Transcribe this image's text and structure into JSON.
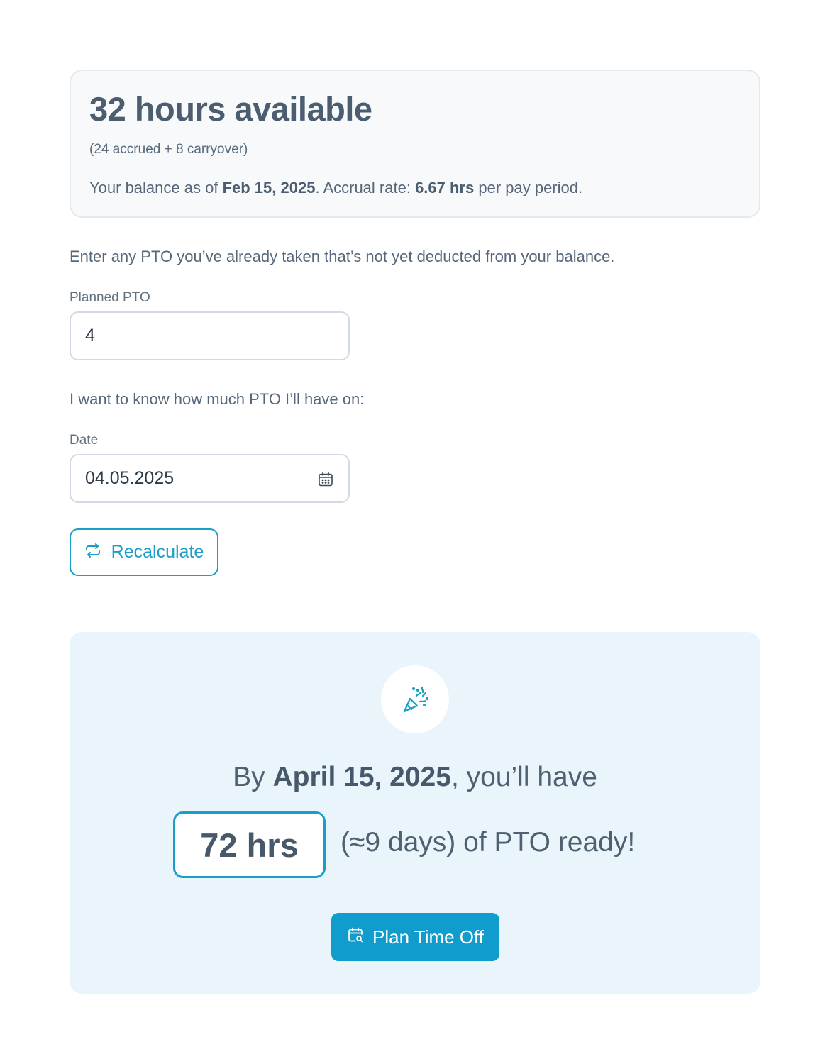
{
  "balance": {
    "title": "32 hours available",
    "breakdown": "(24 accrued + 8 carryover)",
    "info_prefix": "Your balance as of ",
    "as_of_date": "Feb 15, 2025",
    "info_middle": ". Accrual rate: ",
    "accrual_rate": "6.67 hrs",
    "info_suffix": " per pay period."
  },
  "form": {
    "intro": "Enter any PTO you’ve already taken that’s not yet deducted from your balance.",
    "planned_label": "Planned PTO",
    "planned_value": "4",
    "question": "I want to know how much PTO I’ll have on:",
    "date_label": "Date",
    "date_value": "04.05.2025",
    "date_icon": "calendar-icon",
    "recalculate_label": "Recalculate",
    "recalculate_icon": "refresh-icon"
  },
  "result": {
    "icon": "party-popper-icon",
    "by_prefix": "By ",
    "target_date": "April 15, 2025",
    "by_suffix": ", you’ll have",
    "hours": "72 hrs",
    "hours_suffix": "(≈9 days) of PTO ready!",
    "plan_label": "Plan Time Off",
    "plan_icon": "calendar-search-icon"
  },
  "colors": {
    "accent": "#1a9ec8",
    "button_fill": "#109ccc",
    "result_bg": "#eaf4fb",
    "text": "#4a5d70"
  }
}
